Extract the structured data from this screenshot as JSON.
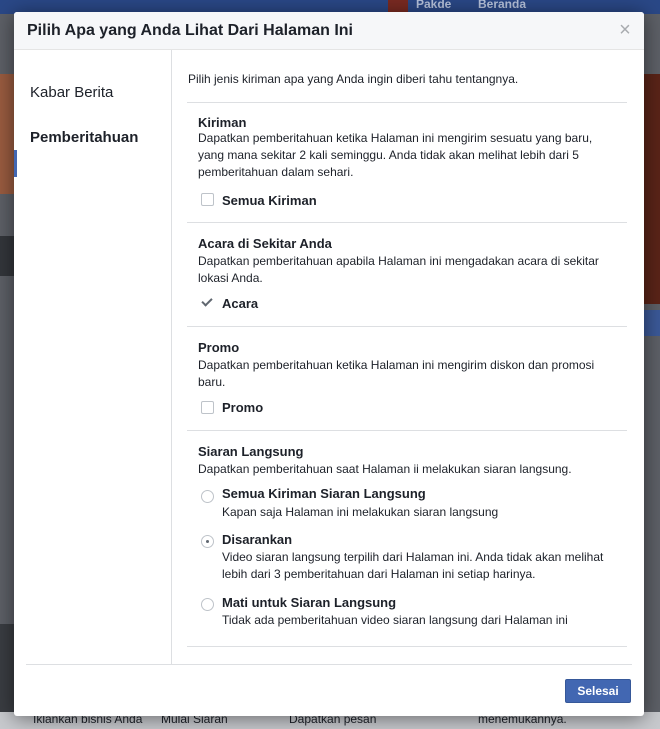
{
  "background": {
    "top_user": "Pakde",
    "top_home": "Beranda",
    "bottom_links": [
      "Iklankan bisnis Anda",
      "Mulai Siaran",
      "Dapatkan pesan"
    ],
    "bottom_right_text": "menemukannya."
  },
  "dialog": {
    "title": "Pilih Apa yang Anda Lihat Dari Halaman Ini",
    "close_label": "×",
    "nav": {
      "items": [
        {
          "label": "Kabar Berita"
        },
        {
          "label": "Pemberitahuan"
        }
      ]
    },
    "intro": "Pilih jenis kiriman apa yang Anda ingin diberi tahu tentangnya.",
    "sections": {
      "posts": {
        "title": "Kiriman",
        "description": "Dapatkan pemberitahuan ketika Halaman ini mengirim sesuatu yang baru, yang mana sekitar 2 kali seminggu. Anda tidak akan melihat lebih dari 5 pemberitahuan dalam sehari.",
        "option_label": "Semua Kiriman",
        "checked": false
      },
      "events": {
        "title": "Acara di Sekitar Anda",
        "description": "Dapatkan pemberitahuan apabila Halaman ini mengadakan acara di sekitar lokasi Anda.",
        "option_label": "Acara",
        "checked": true
      },
      "offers": {
        "title": "Promo",
        "description": "Dapatkan pemberitahuan ketika Halaman ini mengirim diskon dan promosi baru.",
        "option_label": "Promo",
        "checked": false
      },
      "live": {
        "title": "Siaran Langsung",
        "description": "Dapatkan pemberitahuan saat Halaman ii melakukan siaran langsung.",
        "options": [
          {
            "label": "Semua Kiriman Siaran Langsung",
            "description": "Kapan saja Halaman ini melakukan siaran langsung",
            "selected": false
          },
          {
            "label": "Disarankan",
            "description": "Video siaran langsung terpilih dari Halaman ini. Anda tidak akan melihat lebih dari 3 pemberitahuan dari Halaman ini setiap harinya.",
            "selected": true
          },
          {
            "label": "Mati untuk Siaran Langsung",
            "description": "Tidak ada pemberitahuan video siaran langsung dari Halaman ini",
            "selected": false
          }
        ]
      }
    },
    "done_label": "Selesai"
  }
}
